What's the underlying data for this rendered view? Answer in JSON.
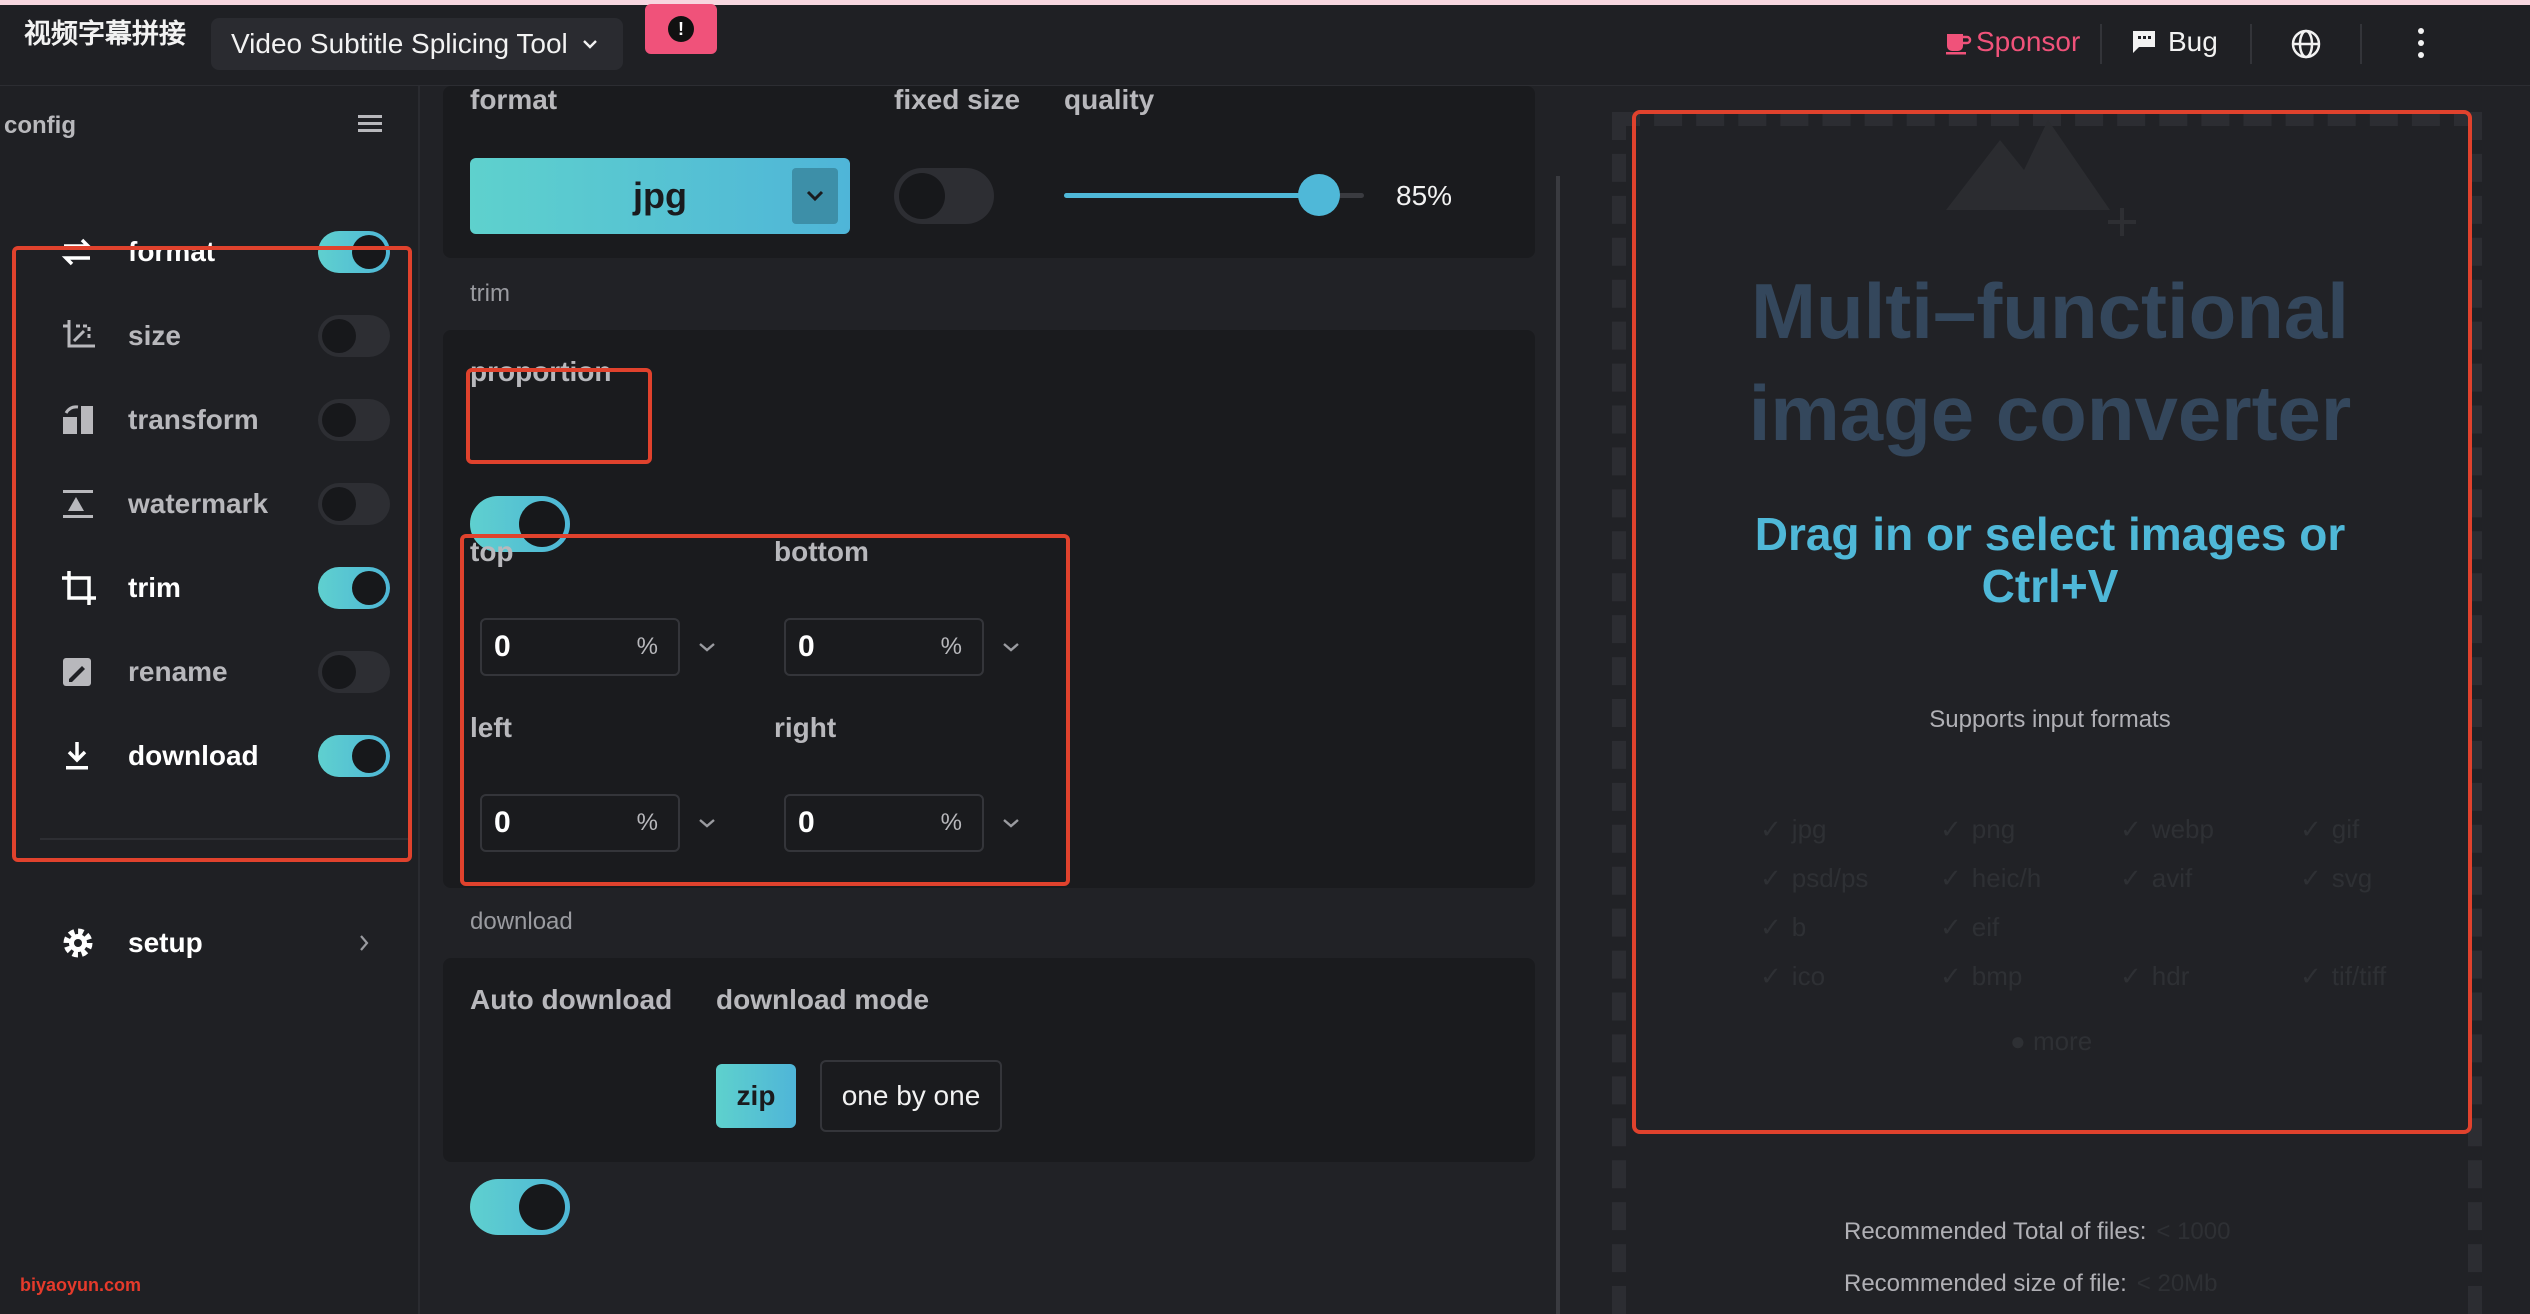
{
  "header": {
    "brand": "视频字幕拼接",
    "tool_select": "Video Subtitle Splicing Tool",
    "alert_symbol": "!",
    "sponsor": "Sponsor",
    "bug": "Bug"
  },
  "sidebar": {
    "title": "config",
    "items": [
      {
        "label": "format",
        "icon": "swap-arrows-icon",
        "enabled": true
      },
      {
        "label": "size",
        "icon": "crop-resize-icon",
        "enabled": false
      },
      {
        "label": "transform",
        "icon": "transform-icon",
        "enabled": false
      },
      {
        "label": "watermark",
        "icon": "watermark-icon",
        "enabled": false
      },
      {
        "label": "trim",
        "icon": "crop-icon",
        "enabled": true
      },
      {
        "label": "rename",
        "icon": "rename-icon",
        "enabled": false
      },
      {
        "label": "download",
        "icon": "download-icon",
        "enabled": true
      }
    ],
    "setup": "setup",
    "watermark_text": "biyaoyun.com"
  },
  "format_section": {
    "format_label": "format",
    "format_value": "jpg",
    "fixed_size_label": "fixed size",
    "fixed_size_on": false,
    "quality_label": "quality",
    "quality_value": "85%",
    "quality_fraction": 0.85
  },
  "trim_section": {
    "section_label": "trim",
    "proportion_label": "proportion",
    "proportion_on": true,
    "top_label": "top",
    "top_value": "0",
    "bottom_label": "bottom",
    "bottom_value": "0",
    "left_label": "left",
    "left_value": "0",
    "right_label": "right",
    "right_value": "0",
    "unit": "%"
  },
  "download_section": {
    "section_label": "download",
    "auto_label": "Auto download",
    "auto_on": true,
    "mode_label": "download mode",
    "mode_zip": "zip",
    "mode_one": "one by one"
  },
  "dropzone": {
    "title_line1": "Multi–functional",
    "title_line2": "image converter",
    "drag_line1": "Drag in or select images or",
    "drag_line2": "Ctrl+V",
    "supports": "Supports input formats",
    "formats": [
      "jpg",
      "png",
      "webp",
      "gif",
      "psd/ps",
      "heic/h",
      "avif",
      "svg",
      "b",
      "eif",
      "",
      "",
      "ico",
      "bmp",
      "hdr",
      "tif/tiff"
    ],
    "more": "more",
    "rec_total_label": "Recommended Total of files:",
    "rec_total_value": "< 1000",
    "rec_size_label": "Recommended size of file:",
    "rec_size_value": "< 20Mb"
  },
  "colors": {
    "accent": "#4fb8d8",
    "sponsor": "#f0527a",
    "highlight_box": "#e0422d"
  }
}
